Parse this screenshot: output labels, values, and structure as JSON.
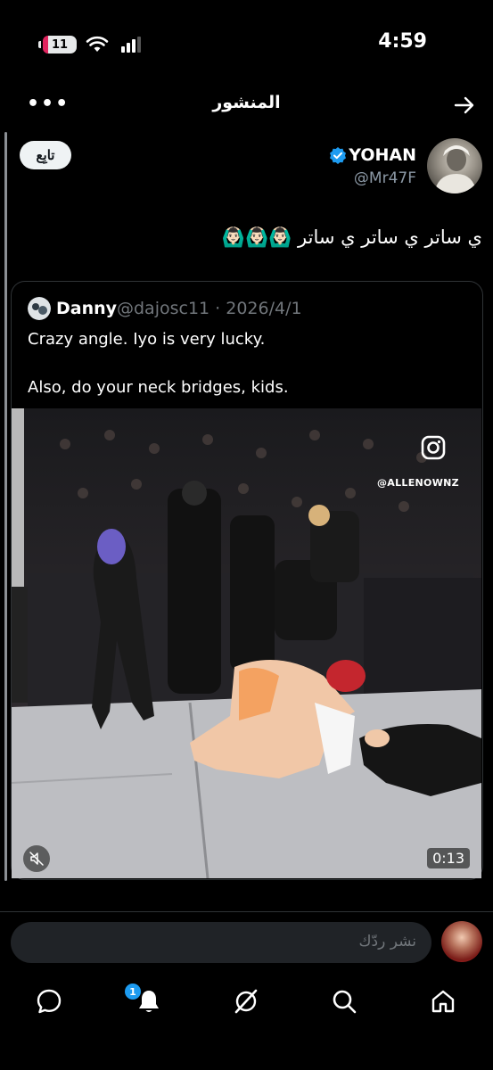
{
  "status_bar": {
    "time": "4:59",
    "battery": "11"
  },
  "header": {
    "title": "المنشور"
  },
  "author": {
    "name": "YOHAN",
    "handle": "@Mr47F"
  },
  "follow_label": "تابِع",
  "post": {
    "text": "ي ساتر ي ساتر ي ساتر 🙆🏻‍♂️🙆🏻‍♂️🙆🏻‍♂️"
  },
  "quote": {
    "name": "Danny",
    "meta": "@dajosc11 · 2026/4/1",
    "line1": "Crazy angle. Iyo is very lucky.",
    "line2": "Also, do your neck bridges, kids.",
    "video": {
      "duration": "0:13",
      "watermark": "@ALLENOWNZ"
    }
  },
  "reply": {
    "placeholder": "نشر ردّك"
  },
  "nav": {
    "notification_count": "1",
    "items": [
      "home-icon",
      "search-icon",
      "grok-icon",
      "notifications-icon",
      "messages-icon"
    ]
  },
  "colors": {
    "accent": "#1d9bf0",
    "background": "#000000"
  }
}
